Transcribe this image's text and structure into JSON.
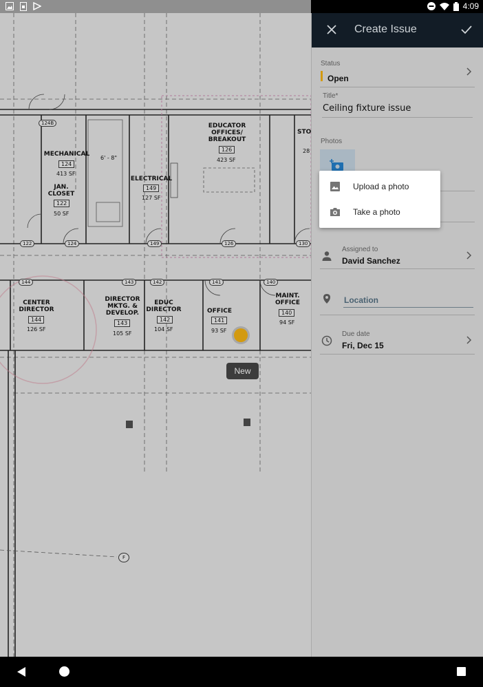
{
  "status_bar": {
    "time": "4:09"
  },
  "floor_plan": {
    "rooms": [
      {
        "name": "EDUCATOR OFFICES/ BREAKOUT",
        "number": "126",
        "sf": "423 SF"
      },
      {
        "name": "MECHANICAL",
        "number": "124",
        "sf": "413 SF"
      },
      {
        "name": "JAN. CLOSET",
        "number": "122",
        "sf": "50 SF"
      },
      {
        "name": "ELECTRICAL",
        "number": "149",
        "sf": "127 SF"
      },
      {
        "name": "STO",
        "number": "28"
      },
      {
        "name": "CENTER DIRECTOR",
        "number": "144",
        "sf": "126 SF"
      },
      {
        "name": "DIRECTOR MKTG. & DEVELOP.",
        "number": "143",
        "sf": "105 SF"
      },
      {
        "name": "EDUC DIRECTOR",
        "number": "142",
        "sf": "104 SF"
      },
      {
        "name": "OFFICE",
        "number": "141",
        "sf": "93 SF"
      },
      {
        "name": "MAINT. OFFICE",
        "number": "140",
        "sf": "94 SF"
      }
    ],
    "bubbles": [
      "124B",
      "122",
      "124",
      "149",
      "126",
      "130",
      "144",
      "143",
      "142",
      "141",
      "140",
      "F"
    ],
    "dimension": "6' - 8\"",
    "pin_tooltip": "New",
    "pin_color": "#d39a10"
  },
  "panel": {
    "title": "Create Issue",
    "status": {
      "label": "Status",
      "value": "Open",
      "color": "#d39a10"
    },
    "title_field": {
      "label": "Title*",
      "value": "Ceiling fixture issue"
    },
    "photos": {
      "label": "Photos"
    },
    "photo_menu": {
      "upload": "Upload a photo",
      "take": "Take a photo"
    },
    "assigned": {
      "label": "Assigned to",
      "value": "David Sanchez"
    },
    "location": {
      "placeholder": "Location"
    },
    "due_date": {
      "label": "Due date",
      "value": "Fri, Dec 15"
    }
  }
}
